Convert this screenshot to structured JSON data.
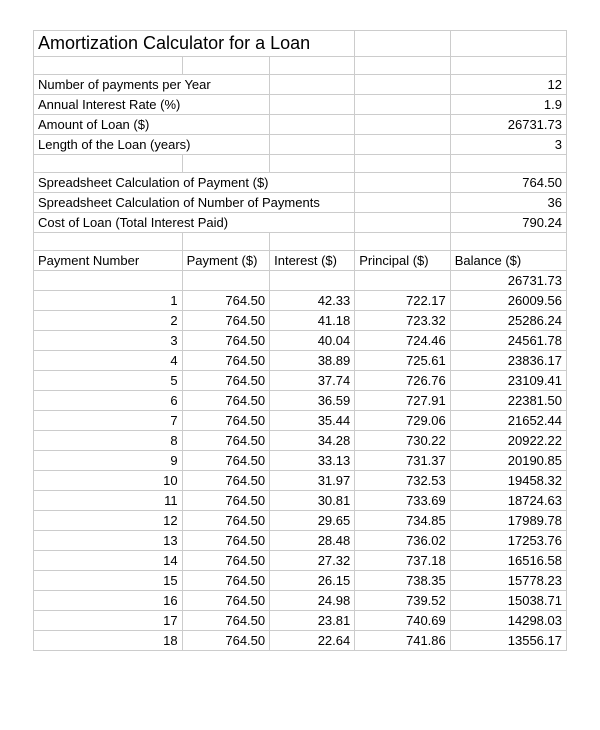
{
  "title": "Amortization Calculator for a Loan",
  "params": [
    {
      "label": "Number of payments per Year",
      "value": "12"
    },
    {
      "label": "Annual Interest Rate (%)",
      "value": "1.9"
    },
    {
      "label": "Amount of Loan ($)",
      "value": "26731.73"
    },
    {
      "label": "Length of the Loan (years)",
      "value": "3"
    }
  ],
  "calcs": [
    {
      "label": "Spreadsheet Calculation of Payment ($)",
      "value": "764.50"
    },
    {
      "label": "Spreadsheet Calculation of Number of Payments",
      "value": "36"
    },
    {
      "label": "Cost of Loan (Total Interest Paid)",
      "value": "790.24"
    }
  ],
  "headers": [
    "Payment Number",
    "Payment ($)",
    "Interest ($)",
    "Principal ($)",
    "Balance ($)"
  ],
  "initial_balance": "26731.73",
  "rows": [
    {
      "n": "1",
      "payment": "764.50",
      "interest": "42.33",
      "principal": "722.17",
      "balance": "26009.56"
    },
    {
      "n": "2",
      "payment": "764.50",
      "interest": "41.18",
      "principal": "723.32",
      "balance": "25286.24"
    },
    {
      "n": "3",
      "payment": "764.50",
      "interest": "40.04",
      "principal": "724.46",
      "balance": "24561.78"
    },
    {
      "n": "4",
      "payment": "764.50",
      "interest": "38.89",
      "principal": "725.61",
      "balance": "23836.17"
    },
    {
      "n": "5",
      "payment": "764.50",
      "interest": "37.74",
      "principal": "726.76",
      "balance": "23109.41"
    },
    {
      "n": "6",
      "payment": "764.50",
      "interest": "36.59",
      "principal": "727.91",
      "balance": "22381.50"
    },
    {
      "n": "7",
      "payment": "764.50",
      "interest": "35.44",
      "principal": "729.06",
      "balance": "21652.44"
    },
    {
      "n": "8",
      "payment": "764.50",
      "interest": "34.28",
      "principal": "730.22",
      "balance": "20922.22"
    },
    {
      "n": "9",
      "payment": "764.50",
      "interest": "33.13",
      "principal": "731.37",
      "balance": "20190.85"
    },
    {
      "n": "10",
      "payment": "764.50",
      "interest": "31.97",
      "principal": "732.53",
      "balance": "19458.32"
    },
    {
      "n": "11",
      "payment": "764.50",
      "interest": "30.81",
      "principal": "733.69",
      "balance": "18724.63"
    },
    {
      "n": "12",
      "payment": "764.50",
      "interest": "29.65",
      "principal": "734.85",
      "balance": "17989.78"
    },
    {
      "n": "13",
      "payment": "764.50",
      "interest": "28.48",
      "principal": "736.02",
      "balance": "17253.76"
    },
    {
      "n": "14",
      "payment": "764.50",
      "interest": "27.32",
      "principal": "737.18",
      "balance": "16516.58"
    },
    {
      "n": "15",
      "payment": "764.50",
      "interest": "26.15",
      "principal": "738.35",
      "balance": "15778.23"
    },
    {
      "n": "16",
      "payment": "764.50",
      "interest": "24.98",
      "principal": "739.52",
      "balance": "15038.71"
    },
    {
      "n": "17",
      "payment": "764.50",
      "interest": "23.81",
      "principal": "740.69",
      "balance": "14298.03"
    },
    {
      "n": "18",
      "payment": "764.50",
      "interest": "22.64",
      "principal": "741.86",
      "balance": "13556.17"
    }
  ]
}
